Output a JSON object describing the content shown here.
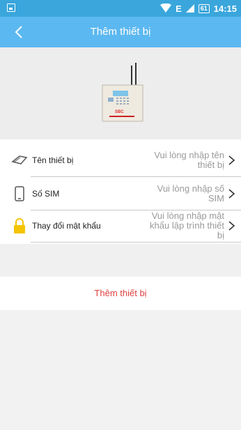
{
  "status_bar": {
    "battery": "61",
    "network": "E",
    "time": "14:15"
  },
  "header": {
    "title": "Thêm thiết bị"
  },
  "form": {
    "rows": [
      {
        "label": "Tên thiết bị",
        "placeholder": "Vui lòng nhập tên thiết bị",
        "icon": "tag-icon"
      },
      {
        "label": "Số SIM",
        "placeholder": "Vui lòng nhập số SIM",
        "icon": "phone-icon"
      },
      {
        "label": "Thay đổi mật khẩu",
        "placeholder": "Vui lòng nhập mật khẩu lập trình thiết bị",
        "icon": "lock-icon"
      }
    ]
  },
  "device_image": {
    "brand": "SBC"
  },
  "action": {
    "label": "Thêm thiết bị"
  },
  "colors": {
    "status_bar": "#3aa6dc",
    "app_bar": "#5cb8f0",
    "action_text": "#e04040",
    "lock_icon": "#f5c400"
  }
}
